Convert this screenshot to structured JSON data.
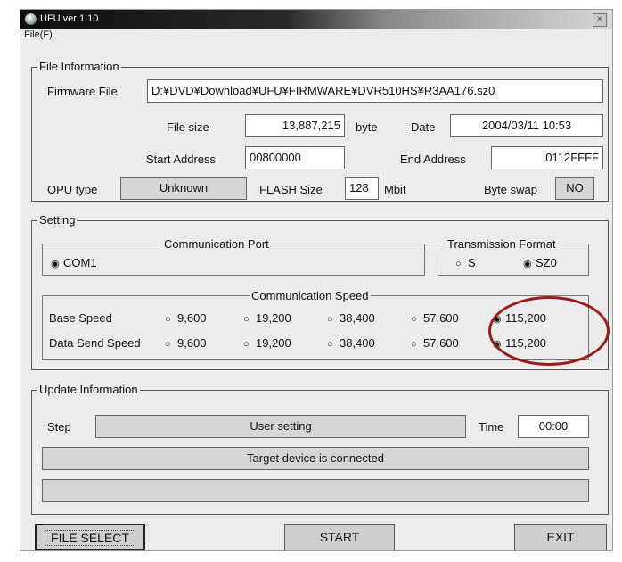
{
  "window": {
    "title": "UFU  ver 1.10",
    "close_label": "×"
  },
  "menu": {
    "file": "File(F)"
  },
  "file_info": {
    "group_label": "File Information",
    "firmware_label": "Firmware File",
    "firmware_path": "D:¥DVD¥Download¥UFU¥FIRMWARE¥DVR510HS¥R3AA176.sz0",
    "file_size_label": "File size",
    "file_size_value": "13,887,215",
    "file_size_unit": "byte",
    "date_label": "Date",
    "date_value": "2004/03/11 10:53",
    "start_address_label": "Start Address",
    "start_address_value": "00800000",
    "end_address_label": "End Address",
    "end_address_value": "0112FFFF",
    "opu_label": "OPU type",
    "opu_value": "Unknown",
    "flash_label": "FLASH Size",
    "flash_value": "128",
    "flash_unit": "Mbit",
    "byte_swap_label": "Byte swap",
    "byte_swap_value": "NO"
  },
  "setting": {
    "group_label": "Setting",
    "comm_port_label": "Communication Port",
    "comm_port_selected": "COM1",
    "transmission_label": "Transmission Format",
    "transmission_options": [
      "S",
      "SZ0"
    ],
    "transmission_selected": "SZ0",
    "comm_speed_label": "Communication Speed",
    "base_speed_label": "Base Speed",
    "data_send_speed_label": "Data Send Speed",
    "speed_options": [
      "9,600",
      "19,200",
      "38,400",
      "57,600",
      "115,200"
    ],
    "base_speed_selected": "115,200",
    "data_send_speed_selected": "115,200"
  },
  "update": {
    "group_label": "Update Information",
    "step_label": "Step",
    "step_value": "User setting",
    "time_label": "Time",
    "time_value": "00:00",
    "status_message": "Target device is connected",
    "progress_fraction": 0
  },
  "buttons": {
    "file_select": "FILE SELECT",
    "start": "START",
    "exit": "EXIT"
  },
  "colors": {
    "highlight_circle": "#9b1b1b",
    "title_bar": "#0d0d0d"
  }
}
